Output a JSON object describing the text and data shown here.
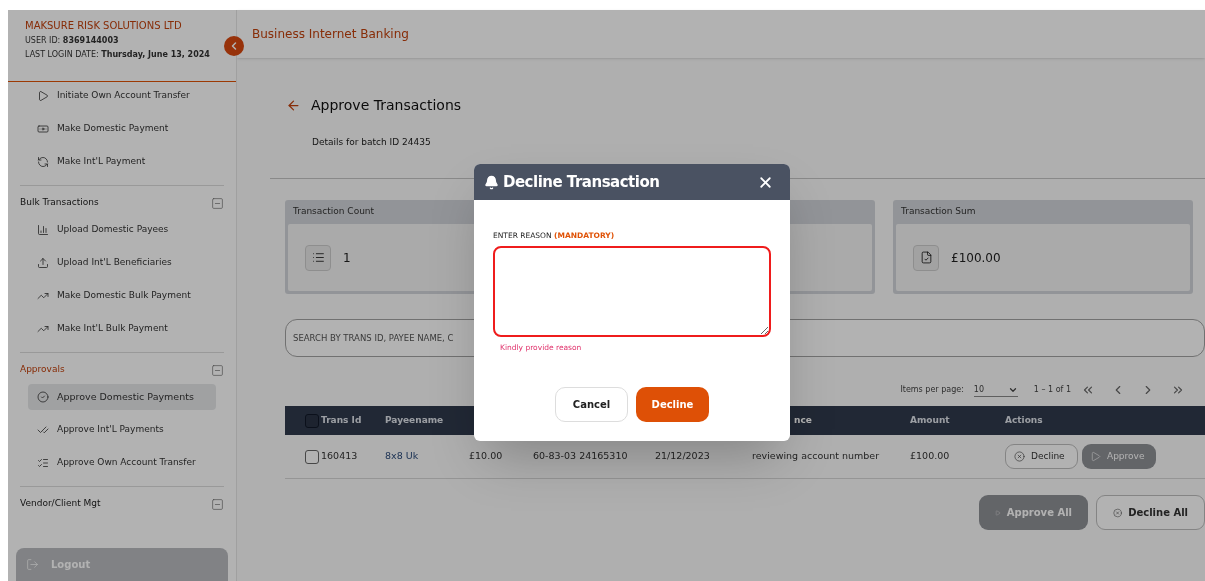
{
  "sidebar": {
    "company": "MAKSURE RISK SOLUTIONS LTD",
    "user_id_label": "USER ID:",
    "user_id": "8369144003",
    "last_login_label": "LAST LOGIN DATE:",
    "last_login": "Thursday, June 13, 2024",
    "items": [
      {
        "label": "Initiate Own Account Transfer",
        "selected": false
      },
      {
        "label": "Make Domestic Payment",
        "selected": false
      },
      {
        "label": "Make Int'L Payment",
        "selected": false
      }
    ],
    "sections": [
      {
        "title": "Bulk Transactions",
        "active": false,
        "expanded": true,
        "items": [
          {
            "label": "Upload Domestic Payees",
            "selected": false
          },
          {
            "label": "Upload Int'L Beneficiaries",
            "selected": false
          },
          {
            "label": "Make Domestic Bulk Payment",
            "selected": false
          },
          {
            "label": "Make Int'L Bulk Payment",
            "selected": false
          }
        ]
      },
      {
        "title": "Approvals",
        "active": true,
        "expanded": true,
        "items": [
          {
            "label": "Approve Domestic Payments",
            "selected": true
          },
          {
            "label": "Approve Int'L Payments",
            "selected": false
          },
          {
            "label": "Approve Own Account Transfer",
            "selected": false
          }
        ]
      },
      {
        "title": "Vendor/Client Mgt",
        "active": false,
        "expanded": true
      }
    ],
    "logout": "Logout"
  },
  "header": {
    "title": "Business Internet Banking"
  },
  "page": {
    "title": "Approve Transactions",
    "subtitle": "Details for batch ID 24435"
  },
  "cards": [
    {
      "kind": "metric",
      "title": "Transaction Count",
      "value": "1"
    },
    {
      "kind": "covered"
    },
    {
      "kind": "metric",
      "title": "Transaction Sum",
      "value": "£100.00"
    }
  ],
  "search": {
    "placeholder": "SEARCH BY TRANS ID, PAYEE NAME, C"
  },
  "pagination": {
    "label": "Items per page:",
    "page_size": "10",
    "range": "1 – 1 of 1"
  },
  "table": {
    "header_checked": false,
    "columns": [
      "Trans Id",
      "Payeename",
      "",
      "",
      "",
      "nce",
      "Amount",
      "Actions"
    ],
    "rows": [
      {
        "checked": false,
        "cells": [
          "160413",
          "8x8 Uk",
          "£10.00",
          "60-83-03 24165310",
          "21/12/2023",
          "reviewing account number",
          "£100.00"
        ],
        "decline": {
          "label": "Decline",
          "disabled": false
        },
        "approve": {
          "label": "Approve",
          "disabled": true
        }
      }
    ]
  },
  "footer_buttons": [
    {
      "label": "Approve All",
      "kind": "approve",
      "disabled": true
    },
    {
      "label": "Decline All",
      "kind": "decline",
      "disabled": false
    }
  ],
  "modal": {
    "title": "Decline Transaction",
    "field_label": "ENTER REASON",
    "field_note": "(MANDATORY)",
    "invalid": true,
    "error": "Kindly provide reason",
    "buttons": [
      {
        "label": "Cancel",
        "kind": "secondary"
      },
      {
        "label": "Decline",
        "kind": "primary"
      }
    ]
  }
}
